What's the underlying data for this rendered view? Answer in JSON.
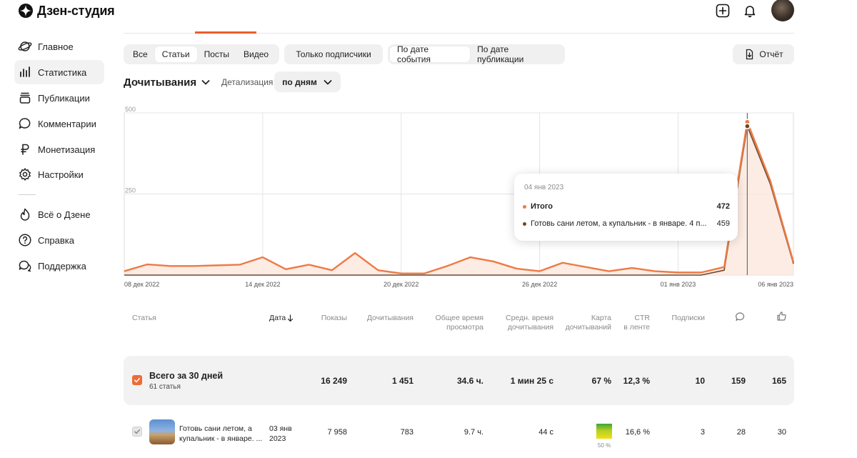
{
  "app": {
    "logo_text": "Дзен-студия"
  },
  "sidebar": {
    "items": [
      {
        "label": "Главное",
        "icon": "planet-icon"
      },
      {
        "label": "Статистика",
        "icon": "bar-chart-icon",
        "active": true
      },
      {
        "label": "Публикации",
        "icon": "layers-icon"
      },
      {
        "label": "Комментарии",
        "icon": "comment-icon"
      },
      {
        "label": "Монетизация",
        "icon": "ruble-icon"
      },
      {
        "label": "Настройки",
        "icon": "gear-icon"
      }
    ],
    "footer_items": [
      {
        "label": "Всё о Дзене",
        "icon": "flame-icon"
      },
      {
        "label": "Справка",
        "icon": "help-icon"
      },
      {
        "label": "Поддержка",
        "icon": "chat-icon"
      }
    ]
  },
  "filters": {
    "content_types": [
      "Все",
      "Статьи",
      "Посты",
      "Видео"
    ],
    "selected_content_type": "Статьи",
    "subscribers_only": "Только подписчики",
    "date_modes": [
      "По дате события",
      "По дате публикации"
    ],
    "selected_date_mode": "По дате события",
    "report_button": "Отчёт"
  },
  "metric": {
    "title": "Дочитывания",
    "detail_label": "Детализация",
    "detail_value": "по дням"
  },
  "colors": {
    "accent": "#ee5d2b",
    "series_total": "#ee7a45",
    "series_article": "#6b4a2e"
  },
  "chart_data": {
    "type": "area",
    "x_ticks": [
      "08 дек 2022",
      "14 дек 2022",
      "20 дек 2022",
      "26 дек 2022",
      "01 янв 2023",
      "06 янв 2023"
    ],
    "y_ticks": [
      "500",
      "250",
      "0"
    ],
    "ylim": [
      0,
      500
    ],
    "grid": true,
    "x": [
      "08 дек",
      "09 дек",
      "10 дек",
      "11 дек",
      "12 дек",
      "13 дек",
      "14 дек",
      "15 дек",
      "16 дек",
      "17 дек",
      "18 дек",
      "19 дек",
      "20 дек",
      "21 дек",
      "22 дек",
      "23 дек",
      "24 дек",
      "25 дек",
      "26 дек",
      "27 дек",
      "28 дек",
      "29 дек",
      "30 дек",
      "31 дек",
      "01 янв",
      "02 янв",
      "03 янв",
      "04 янв",
      "05 янв",
      "06 янв"
    ],
    "series": [
      {
        "name": "Итого",
        "values": [
          12,
          33,
          28,
          28,
          30,
          32,
          55,
          18,
          32,
          15,
          68,
          15,
          5,
          5,
          28,
          55,
          42,
          20,
          12,
          38,
          25,
          12,
          22,
          12,
          8,
          8,
          25,
          472,
          290,
          40
        ]
      },
      {
        "name": "Готовь сани летом, а купальник - в январе. 4 п...",
        "values": [
          0,
          0,
          0,
          0,
          0,
          0,
          0,
          0,
          0,
          0,
          0,
          0,
          0,
          0,
          0,
          0,
          0,
          0,
          0,
          0,
          0,
          0,
          0,
          0,
          0,
          0,
          15,
          459,
          280,
          35
        ]
      }
    ]
  },
  "tooltip": {
    "date": "04 янв 2023",
    "rows": [
      {
        "name": "Итого",
        "value": "472",
        "color": "#ee7a45"
      },
      {
        "name": "Готовь сани летом, а купальник - в январе. 4 п...",
        "value": "459",
        "color": "#6b4a2e"
      }
    ]
  },
  "table": {
    "headers": {
      "article": "Статья",
      "date": "Дата",
      "impressions": "Показы",
      "reads": "Дочитывания",
      "view_time_1": "Общее время",
      "view_time_2": "просмотра",
      "avg_time_1": "Средн. время",
      "avg_time_2": "дочитывания",
      "map_1": "Карта",
      "map_2": "дочитываний",
      "ctr_1": "CTR",
      "ctr_2": "в ленте",
      "subs": "Подписки"
    },
    "total": {
      "title": "Всего за 30 дней",
      "subtitle": "61 статья",
      "impressions": "16 249",
      "reads": "1 451",
      "view_time": "34.6 ч.",
      "avg_time": "1 мин 25 с",
      "map": "67 %",
      "ctr": "12,3 %",
      "subs": "10",
      "comments": "159",
      "likes": "165"
    },
    "rows": [
      {
        "title_1": "Готовь сани летом, а",
        "title_2": "купальник - в январе. ...",
        "date_1": "03 янв",
        "date_2": "2023",
        "impressions": "7 958",
        "reads": "783",
        "view_time": "9.7 ч.",
        "avg_time": "44 с",
        "map_pct": "50 %",
        "ctr": "16,6 %",
        "subs": "3",
        "comments": "28",
        "likes": "30"
      }
    ]
  }
}
